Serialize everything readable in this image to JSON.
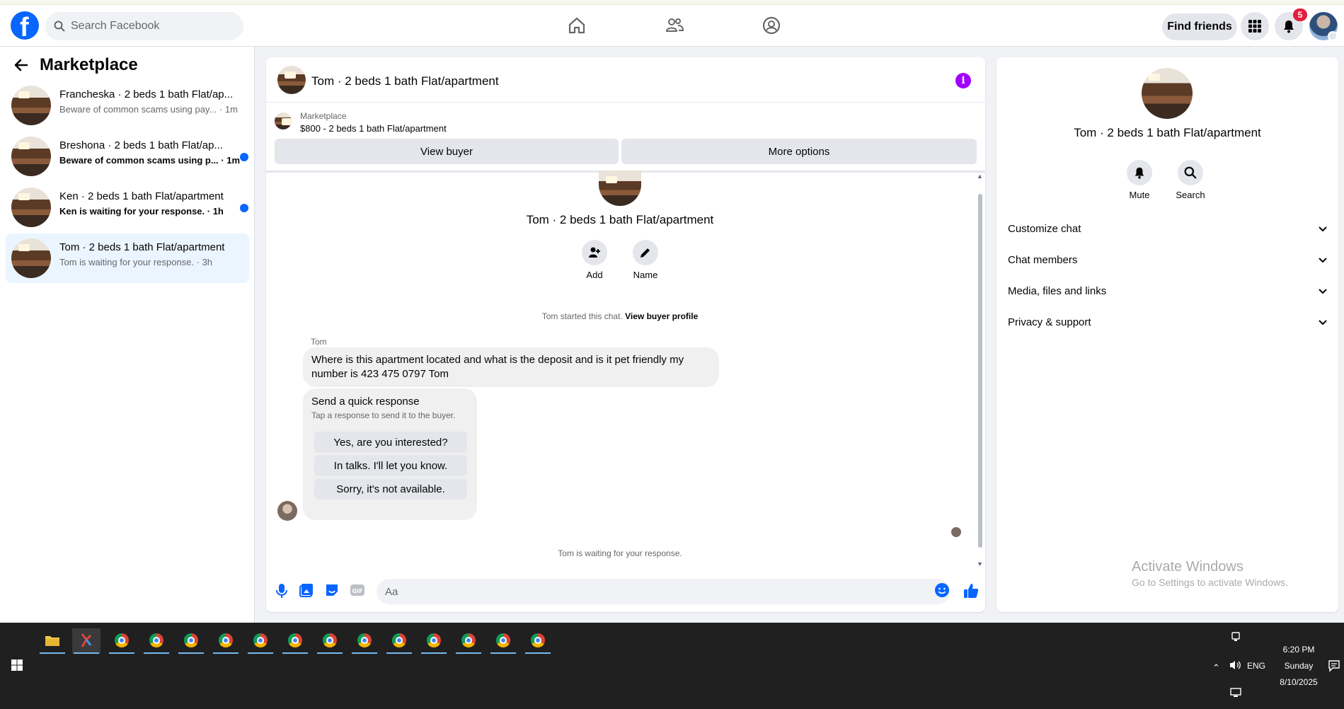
{
  "topbar": {
    "search_placeholder": "Search Facebook",
    "find_friends": "Find friends",
    "notification_count": "5"
  },
  "sidebar": {
    "title": "Marketplace",
    "conversations": [
      {
        "title": "Francheska · 2 beds 1 bath Flat/ap...",
        "subtitle": "Beware of common scams using pay... · 1m",
        "unread": false
      },
      {
        "title": "Breshona · 2 beds 1 bath Flat/ap...",
        "subtitle": "Beware of common scams using p... · 1m",
        "unread": true
      },
      {
        "title": "Ken · 2 beds 1 bath Flat/apartment",
        "subtitle": "Ken is waiting for your response. · 1h",
        "unread": true
      },
      {
        "title": "Tom · 2 beds 1 bath Flat/apartment",
        "subtitle": "Tom is waiting for your response. · 3h",
        "unread": false,
        "active": true
      }
    ]
  },
  "chat": {
    "header_title": "Tom · 2 beds 1 bath Flat/apartment",
    "marketplace_label": "Marketplace",
    "listing": "$800 - 2 beds 1 bath Flat/apartment",
    "view_buyer": "View buyer",
    "more_options": "More options",
    "name": "Tom · 2 beds 1 bath Flat/apartment",
    "add_label": "Add",
    "name_label": "Name",
    "started_text": "Tom started this chat. ",
    "view_profile": "View buyer profile",
    "sender": "Tom",
    "message": "Where is this apartment located  and what is the deposit and is it pet friendly  my number is 423 475 0797  Tom",
    "quick_title": "Send a quick response",
    "quick_sub": "Tap a response to send it to the buyer.",
    "quick_responses": [
      "Yes, are you interested?",
      "In talks. I'll let you know.",
      "Sorry, it's not available."
    ],
    "waiting": "Tom is waiting for your response.",
    "input_placeholder": "Aa"
  },
  "rpanel": {
    "name": "Tom · 2 beds 1 bath Flat/apartment",
    "mute": "Mute",
    "search": "Search",
    "sections": [
      "Customize chat",
      "Chat members",
      "Media, files and links",
      "Privacy & support"
    ]
  },
  "watermark": {
    "title": "Activate Windows",
    "subtitle": "Go to Settings to activate Windows."
  },
  "taskbar": {
    "time": "6:20 PM",
    "day": "Sunday",
    "date": "8/10/2025",
    "lang": "ENG"
  },
  "colors": {
    "brand": "#0866ff",
    "active_conv": "#ebf5ff",
    "info": "#a100ff"
  }
}
